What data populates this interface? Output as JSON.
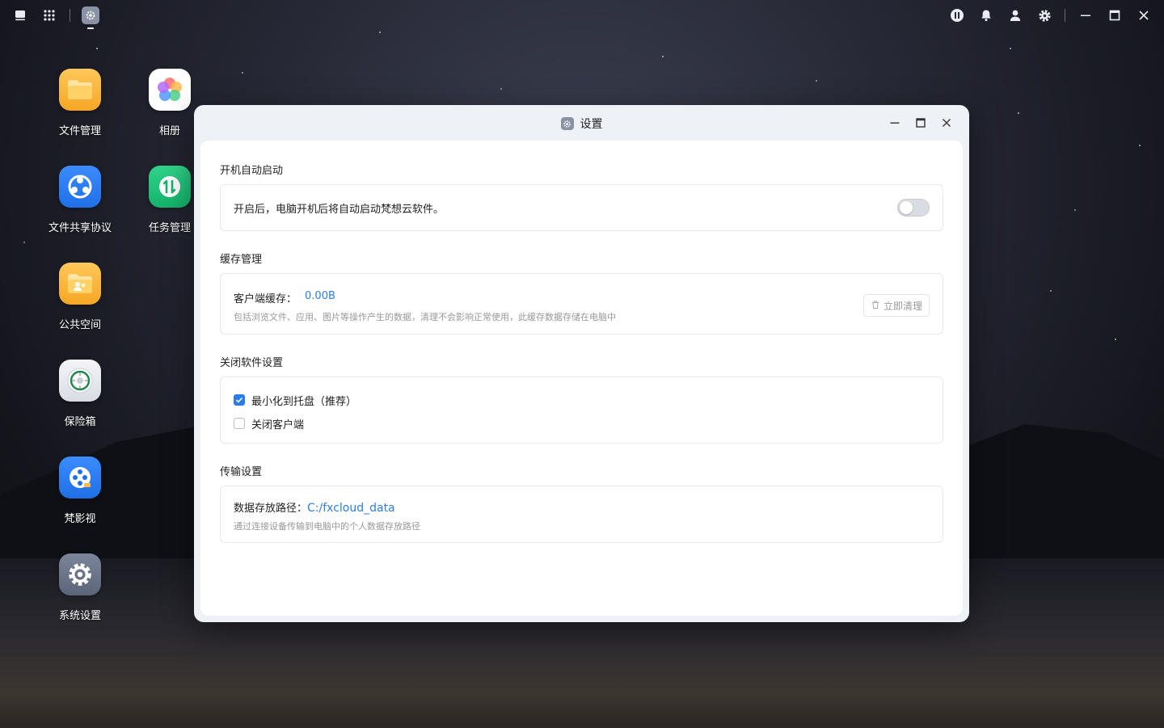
{
  "desktop": {
    "icons": [
      {
        "label": "文件管理",
        "icon": "folder-icon",
        "color": "#f9b233"
      },
      {
        "label": "相册",
        "icon": "photos-icon",
        "color": "#ffffff"
      },
      {
        "label": "文件共享协议",
        "icon": "share-protocol-icon",
        "color": "#2f7ef0"
      },
      {
        "label": "任务管理",
        "icon": "task-manager-icon",
        "color": "#1fbf7a"
      },
      {
        "label": "公共空间",
        "icon": "public-space-icon",
        "color": "#f9b233"
      },
      {
        "label": "保险箱",
        "icon": "safe-icon",
        "color": "#e8ebef"
      },
      {
        "label": "梵影视",
        "icon": "video-icon",
        "color": "#2f7ef0"
      },
      {
        "label": "系统设置",
        "icon": "system-settings-icon",
        "color": "#6b7488"
      }
    ]
  },
  "window": {
    "title": "设置",
    "sections": {
      "autostart": {
        "title": "开机自动启动",
        "desc": "开启后，电脑开机后将自动启动梵想云软件。",
        "enabled": false
      },
      "cache": {
        "title": "缓存管理",
        "label": "客户端缓存：",
        "value": "0.00B",
        "hint": "包括浏览文件、应用、图片等操作产生的数据，清理不会影响正常使用，此缓存数据存储在电脑中",
        "clear_label": "立即清理"
      },
      "close": {
        "title": "关闭软件设置",
        "options": [
          {
            "label": "最小化到托盘（推荐）",
            "checked": true
          },
          {
            "label": "关闭客户端",
            "checked": false
          }
        ]
      },
      "transfer": {
        "title": "传输设置",
        "label": "数据存放路径：",
        "path": "C:/fxcloud_data",
        "hint": "通过连接设备传输到电脑中的个人数据存放路径"
      }
    }
  },
  "colors": {
    "accent": "#2b7de9"
  }
}
